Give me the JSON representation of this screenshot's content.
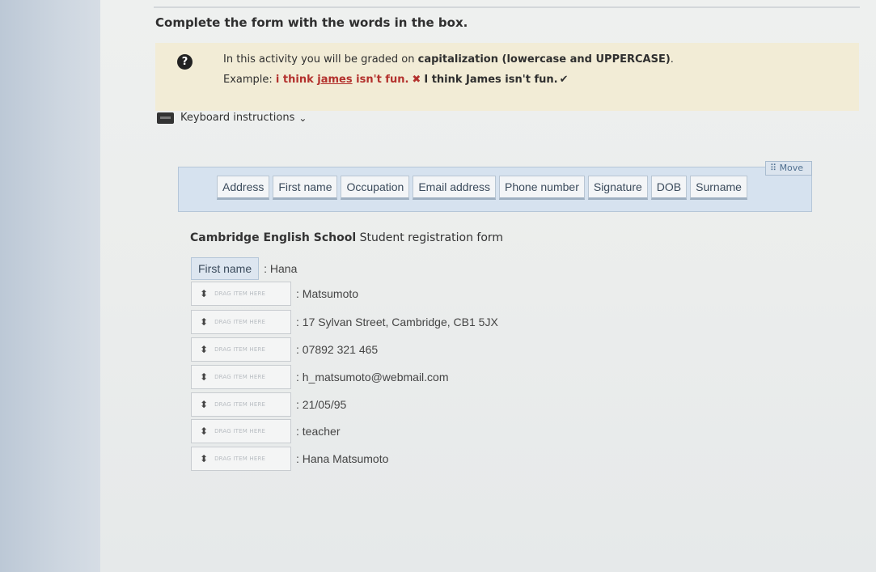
{
  "heading": "Complete the form with the words in the box.",
  "info": {
    "line1_prefix": "In this activity you will be graded on ",
    "line1_bold": "capitalization (lowercase and UPPERCASE)",
    "line1_suffix": ".",
    "example_label": "Example: ",
    "wrong_part1": "i think ",
    "wrong_underlined": "james",
    "wrong_part2": " isn't fun.",
    "x_mark": "✖",
    "right_example": "I think James isn't fun.",
    "check_mark": "✔"
  },
  "keyboard": {
    "label": "Keyboard instructions",
    "chevron": "⌄"
  },
  "move": {
    "label": "Move"
  },
  "word_bank": [
    "Address",
    "First name",
    "Occupation",
    "Email address",
    "Phone number",
    "Signature",
    "DOB",
    "Surname"
  ],
  "form": {
    "title_bold": "Cambridge English School",
    "title_rest": " Student registration form",
    "first_row": {
      "chip": "First name",
      "value": ": Hana"
    },
    "drop_placeholder": "DRAG ITEM HERE",
    "drop_arrow": "⬍",
    "rows": [
      ": Matsumoto",
      ": 17 Sylvan Street, Cambridge, CB1 5JX",
      ": 07892 321 465",
      ": h_matsumoto@webmail.com",
      ": 21/05/95",
      ": teacher",
      ": Hana Matsumoto"
    ]
  },
  "colors": {
    "info_bg": "#f2ecd6",
    "word_box_bg": "#d6e2ef",
    "wrong_text": "#b3312d"
  }
}
